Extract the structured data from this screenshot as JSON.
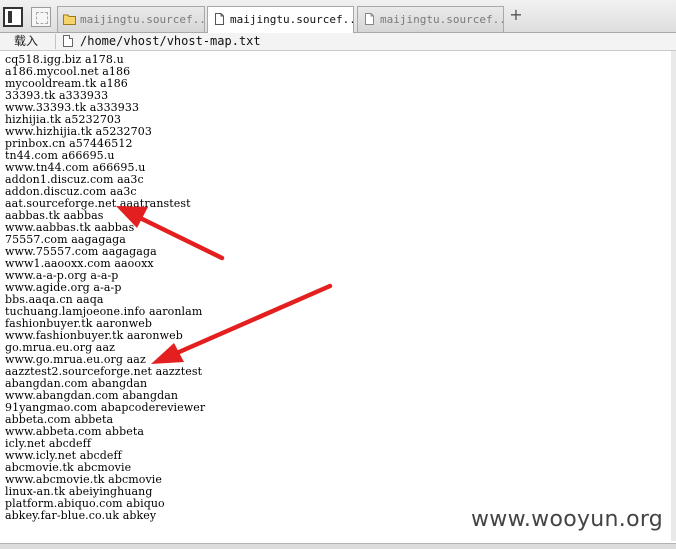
{
  "tabs": [
    {
      "label": "maijingtu.sourcef...",
      "active": false
    },
    {
      "label": "maijingtu.sourcef...",
      "active": true
    },
    {
      "label": "maijingtu.sourcef...",
      "active": false
    }
  ],
  "toolbar": {
    "load_label": "载入"
  },
  "address": {
    "url": "/home/vhost/vhost-map.txt"
  },
  "lines": [
    "cq518.igg.biz a178.u",
    "a186.mycool.net a186",
    "mycooldream.tk a186",
    "33393.tk a333933",
    "www.33393.tk a333933",
    "hizhijia.tk a5232703",
    "www.hizhijia.tk a5232703",
    "prinbox.cn a57446512",
    "tn44.com a66695.u",
    "www.tn44.com a66695.u",
    "addon1.discuz.com aa3c",
    "addon.discuz.com aa3c",
    "aat.sourceforge.net aaatranstest",
    "aabbas.tk aabbas",
    "www.aabbas.tk aabbas",
    "75557.com aagagaga",
    "www.75557.com aagagaga",
    "www1.aaooxx.com aaooxx",
    "www.a-a-p.org a-a-p",
    "www.agide.org a-a-p",
    "bbs.aaqa.cn aaqa",
    "tuchuang.lamjoeone.info aaronlam",
    "fashionbuyer.tk aaronweb",
    "www.fashionbuyer.tk aaronweb",
    "go.mrua.eu.org aaz",
    "www.go.mrua.eu.org aaz",
    "aazztest2.sourceforge.net aazztest",
    "abangdan.com abangdan",
    "www.abangdan.com abangdan",
    "91yangmao.com abapcodereviewer",
    "abbeta.com abbeta",
    "www.abbeta.com abbeta",
    "icly.net abcdeff",
    "www.icly.net abcdeff",
    "abcmovie.tk abcmovie",
    "www.abcmovie.tk abcmovie",
    "linux-an.tk abeiyinghuang",
    "platform.abiquo.com abiquo",
    "abkey.far-blue.co.uk abkey"
  ],
  "watermark": "www.wooyun.org",
  "colors": {
    "arrow": "#e3201f"
  }
}
